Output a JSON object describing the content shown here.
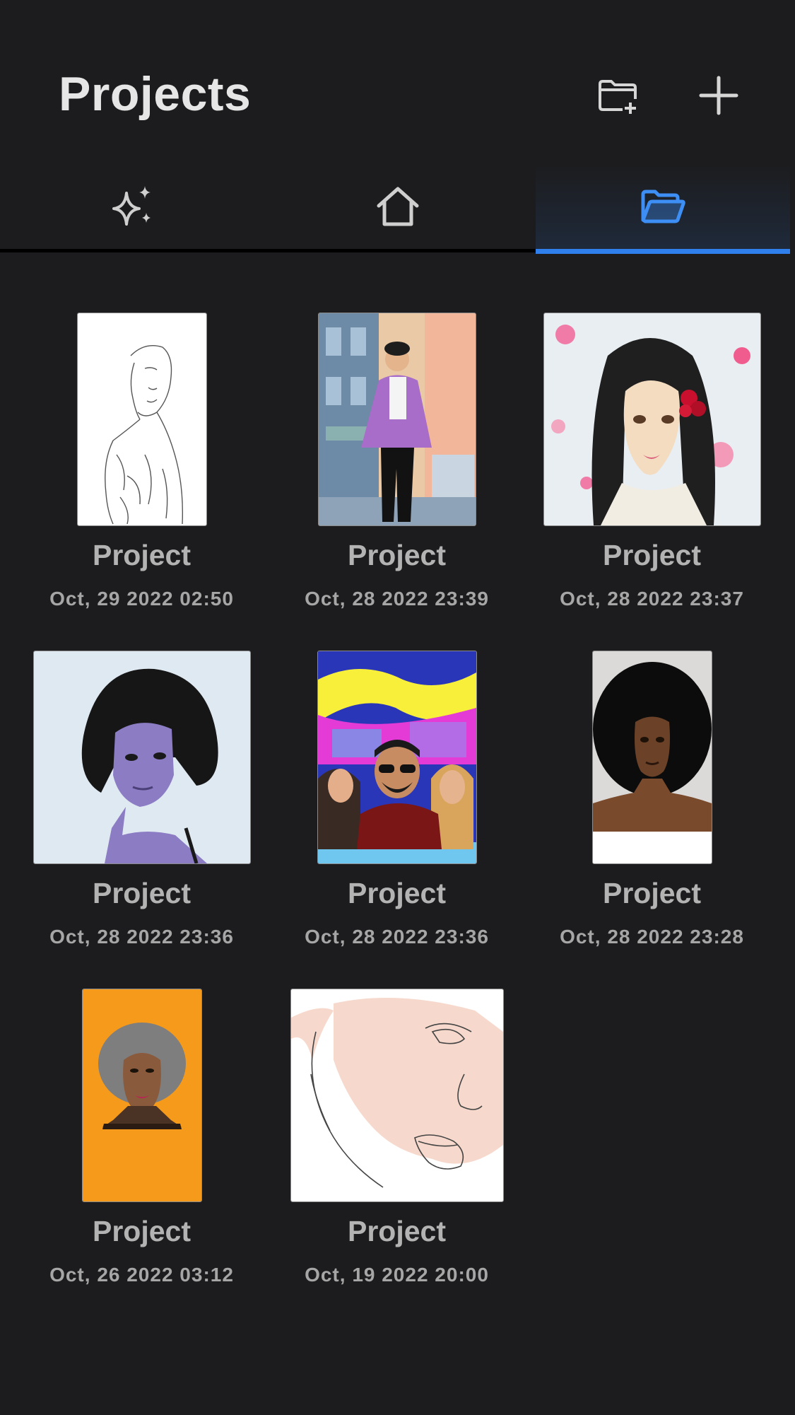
{
  "header": {
    "title": "Projects",
    "new_folder_icon": "folder-plus-icon",
    "add_icon": "plus-icon"
  },
  "tabs": [
    {
      "name": "ideas",
      "icon": "sparkles-icon",
      "active": false
    },
    {
      "name": "home",
      "icon": "house-icon",
      "active": false
    },
    {
      "name": "projects",
      "icon": "folder-open-icon",
      "active": true
    }
  ],
  "colors": {
    "background": "#1c1c1e",
    "accent": "#2f80ed",
    "title": "#e6e6e6",
    "secondary_text": "#b3b3b3"
  },
  "projects": [
    {
      "title": "Project",
      "date": "Oct, 29 2022 02:50",
      "thumbnail": "line-sketch-woman"
    },
    {
      "title": "Project",
      "date": "Oct, 28 2022 23:39",
      "thumbnail": "man-purple-jacket-street"
    },
    {
      "title": "Project",
      "date": "Oct, 28 2022 23:37",
      "thumbnail": "woman-cherry-blossoms"
    },
    {
      "title": "Project",
      "date": "Oct, 28 2022 23:36",
      "thumbnail": "woman-bob-hair-purple"
    },
    {
      "title": "Project",
      "date": "Oct, 28 2022 23:36",
      "thumbnail": "group-neon-city"
    },
    {
      "title": "Project",
      "date": "Oct, 28 2022 23:28",
      "thumbnail": "woman-afro"
    },
    {
      "title": "Project",
      "date": "Oct, 26 2022 03:12",
      "thumbnail": "woman-orange-background"
    },
    {
      "title": "Project",
      "date": "Oct, 19 2022 20:00",
      "thumbnail": "face-closeup-sketch"
    }
  ]
}
